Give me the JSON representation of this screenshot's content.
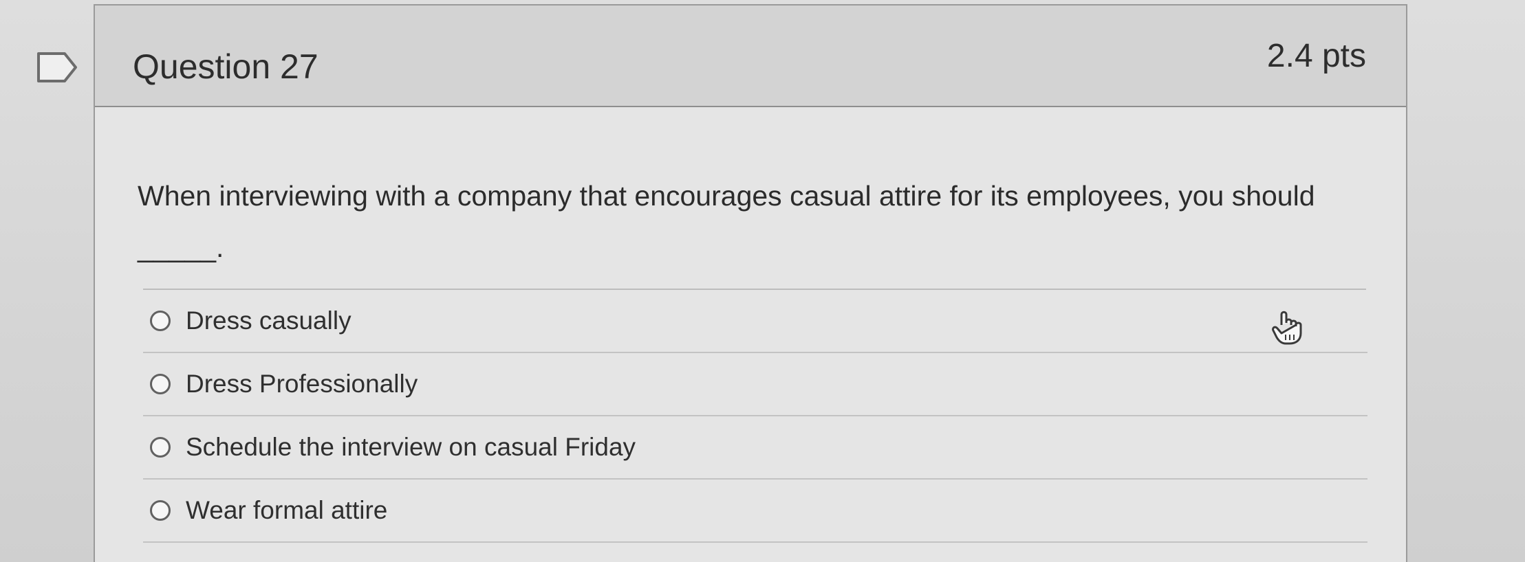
{
  "question": {
    "title": "Question 27",
    "points": "2.4 pts",
    "text": "When interviewing with a company that encourages casual attire for its employees, you should _____."
  },
  "answers": [
    {
      "label": "Dress casually"
    },
    {
      "label": "Dress Professionally"
    },
    {
      "label": "Schedule the interview on casual Friday"
    },
    {
      "label": "Wear formal attire"
    }
  ],
  "icons": {
    "flag": "flag-icon",
    "radio": "radio-button-icon",
    "cursor": "hand-pointer-icon"
  }
}
